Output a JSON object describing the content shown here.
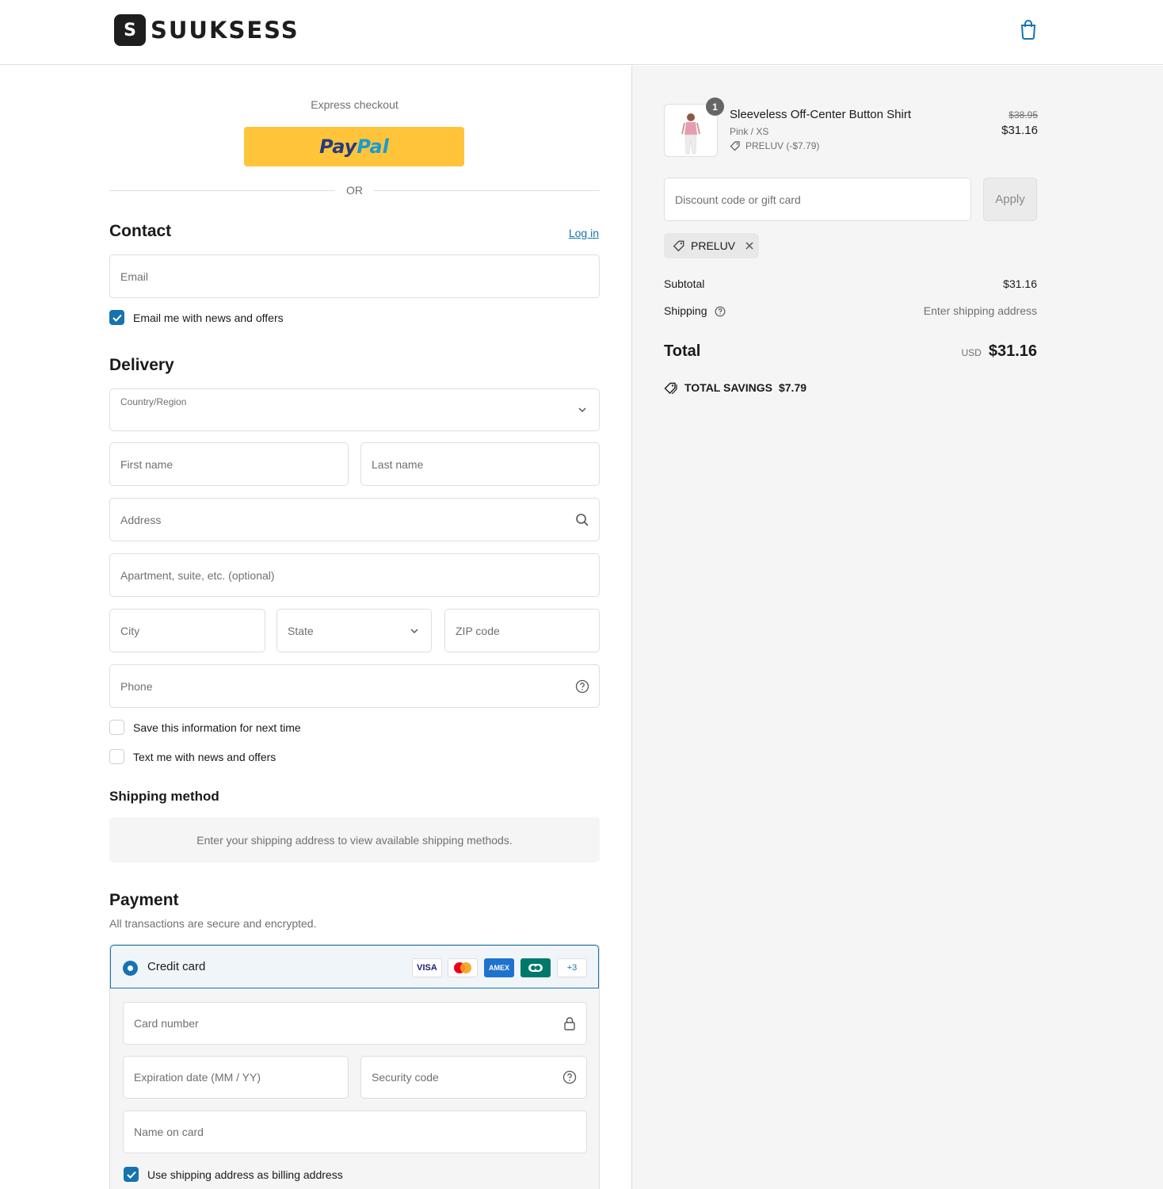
{
  "header": {
    "logo_mark": "S",
    "logo_text": "SUUKSESS",
    "cart_icon": "shopping-bag-icon"
  },
  "express": {
    "label": "Express checkout",
    "paypal_pay": "Pay",
    "paypal_pal": "Pal",
    "or": "OR"
  },
  "contact": {
    "title": "Contact",
    "login": "Log in",
    "email_placeholder": "Email",
    "email_news_label": "Email me with news and offers",
    "email_news_checked": true
  },
  "delivery": {
    "title": "Delivery",
    "country_label": "Country/Region",
    "first_name": "First name",
    "last_name": "Last name",
    "address": "Address",
    "apartment": "Apartment, suite, etc. (optional)",
    "city": "City",
    "state": "State",
    "zip": "ZIP code",
    "phone": "Phone",
    "save_info": "Save this information for next time",
    "text_news": "Text me with news and offers"
  },
  "shipping_method": {
    "title": "Shipping method",
    "note": "Enter your shipping address to view available shipping methods."
  },
  "payment": {
    "title": "Payment",
    "subtitle": "All transactions are secure and encrypted.",
    "credit_card_label": "Credit card",
    "brands": [
      "VISA",
      "",
      "AMEX",
      "",
      "+3"
    ],
    "card_number": "Card number",
    "expiry": "Expiration date (MM / YY)",
    "security": "Security code",
    "name_on_card": "Name on card",
    "billing_same": "Use shipping address as billing address",
    "billing_same_checked": true
  },
  "order": {
    "quantity": "1",
    "item_name": "Sleeveless Off-Center Button Shirt",
    "item_variant": "Pink / XS",
    "item_discount": "PRELUV (-$7.79)",
    "original_price": "$38.95",
    "price": "$31.16",
    "discount_placeholder": "Discount code or gift card",
    "apply": "Apply",
    "applied_code": "PRELUV",
    "subtotal_label": "Subtotal",
    "subtotal": "$31.16",
    "shipping_label": "Shipping",
    "shipping_value": "Enter shipping address",
    "total_label": "Total",
    "currency": "USD",
    "total": "$31.16",
    "savings_label": "TOTAL SAVINGS",
    "savings": "$7.79"
  },
  "colors": {
    "accent": "#1773b0",
    "paypal": "#ffc439",
    "border": "#dedede",
    "sidebar_bg": "#f5f5f5"
  }
}
